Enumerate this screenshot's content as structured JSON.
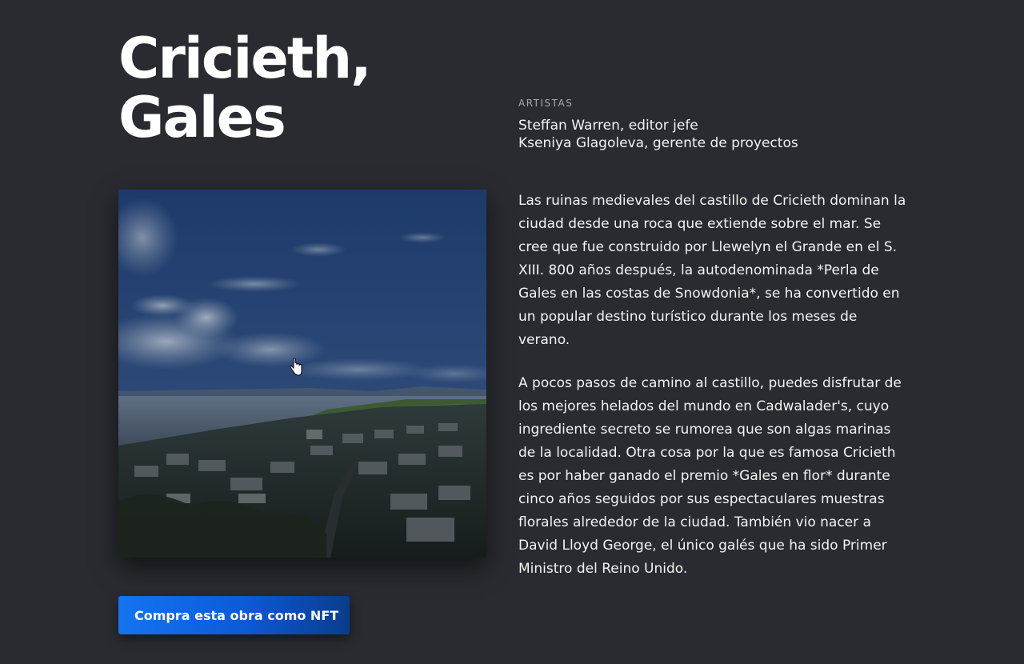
{
  "title": {
    "line1": "Cricieth,",
    "line2": "Gales"
  },
  "artists": {
    "label": "ARTISTAS",
    "names": [
      "Steffan Warren, editor jefe",
      "Kseniya Glagoleva, gerente de proyectos"
    ]
  },
  "artwork": {
    "image_icon": "landscape-photo"
  },
  "description": {
    "paragraphs": [
      "Las ruinas medievales del castillo de Cricieth dominan la ciudad desde una roca que extiende sobre el mar. Se cree que fue construido por Llewelyn el Grande en el S. XIII. 800 años después, la autodenominada *Perla de Gales en las costas de Snowdonia*, se ha convertido en un popular destino turístico durante los meses de verano.",
      "A pocos pasos de camino al castillo, puedes disfrutar de los mejores helados del mundo en Cadwalader's, cuyo ingrediente secreto se rumorea que son algas marinas de la localidad. Otra cosa por la que es famosa Cricieth es por haber ganado el premio *Gales en flor* durante cinco años seguidos por sus espectaculares muestras florales alrededor de la ciudad. También vio nacer a David Lloyd George, el único galés que ha sido Primer Ministro del Reino Unido."
    ]
  },
  "cta": {
    "label": "Compra esta obra como NFT"
  },
  "colors": {
    "background": "#2a2b30",
    "button_start": "#1474f2",
    "button_end": "#0a3c8c"
  }
}
